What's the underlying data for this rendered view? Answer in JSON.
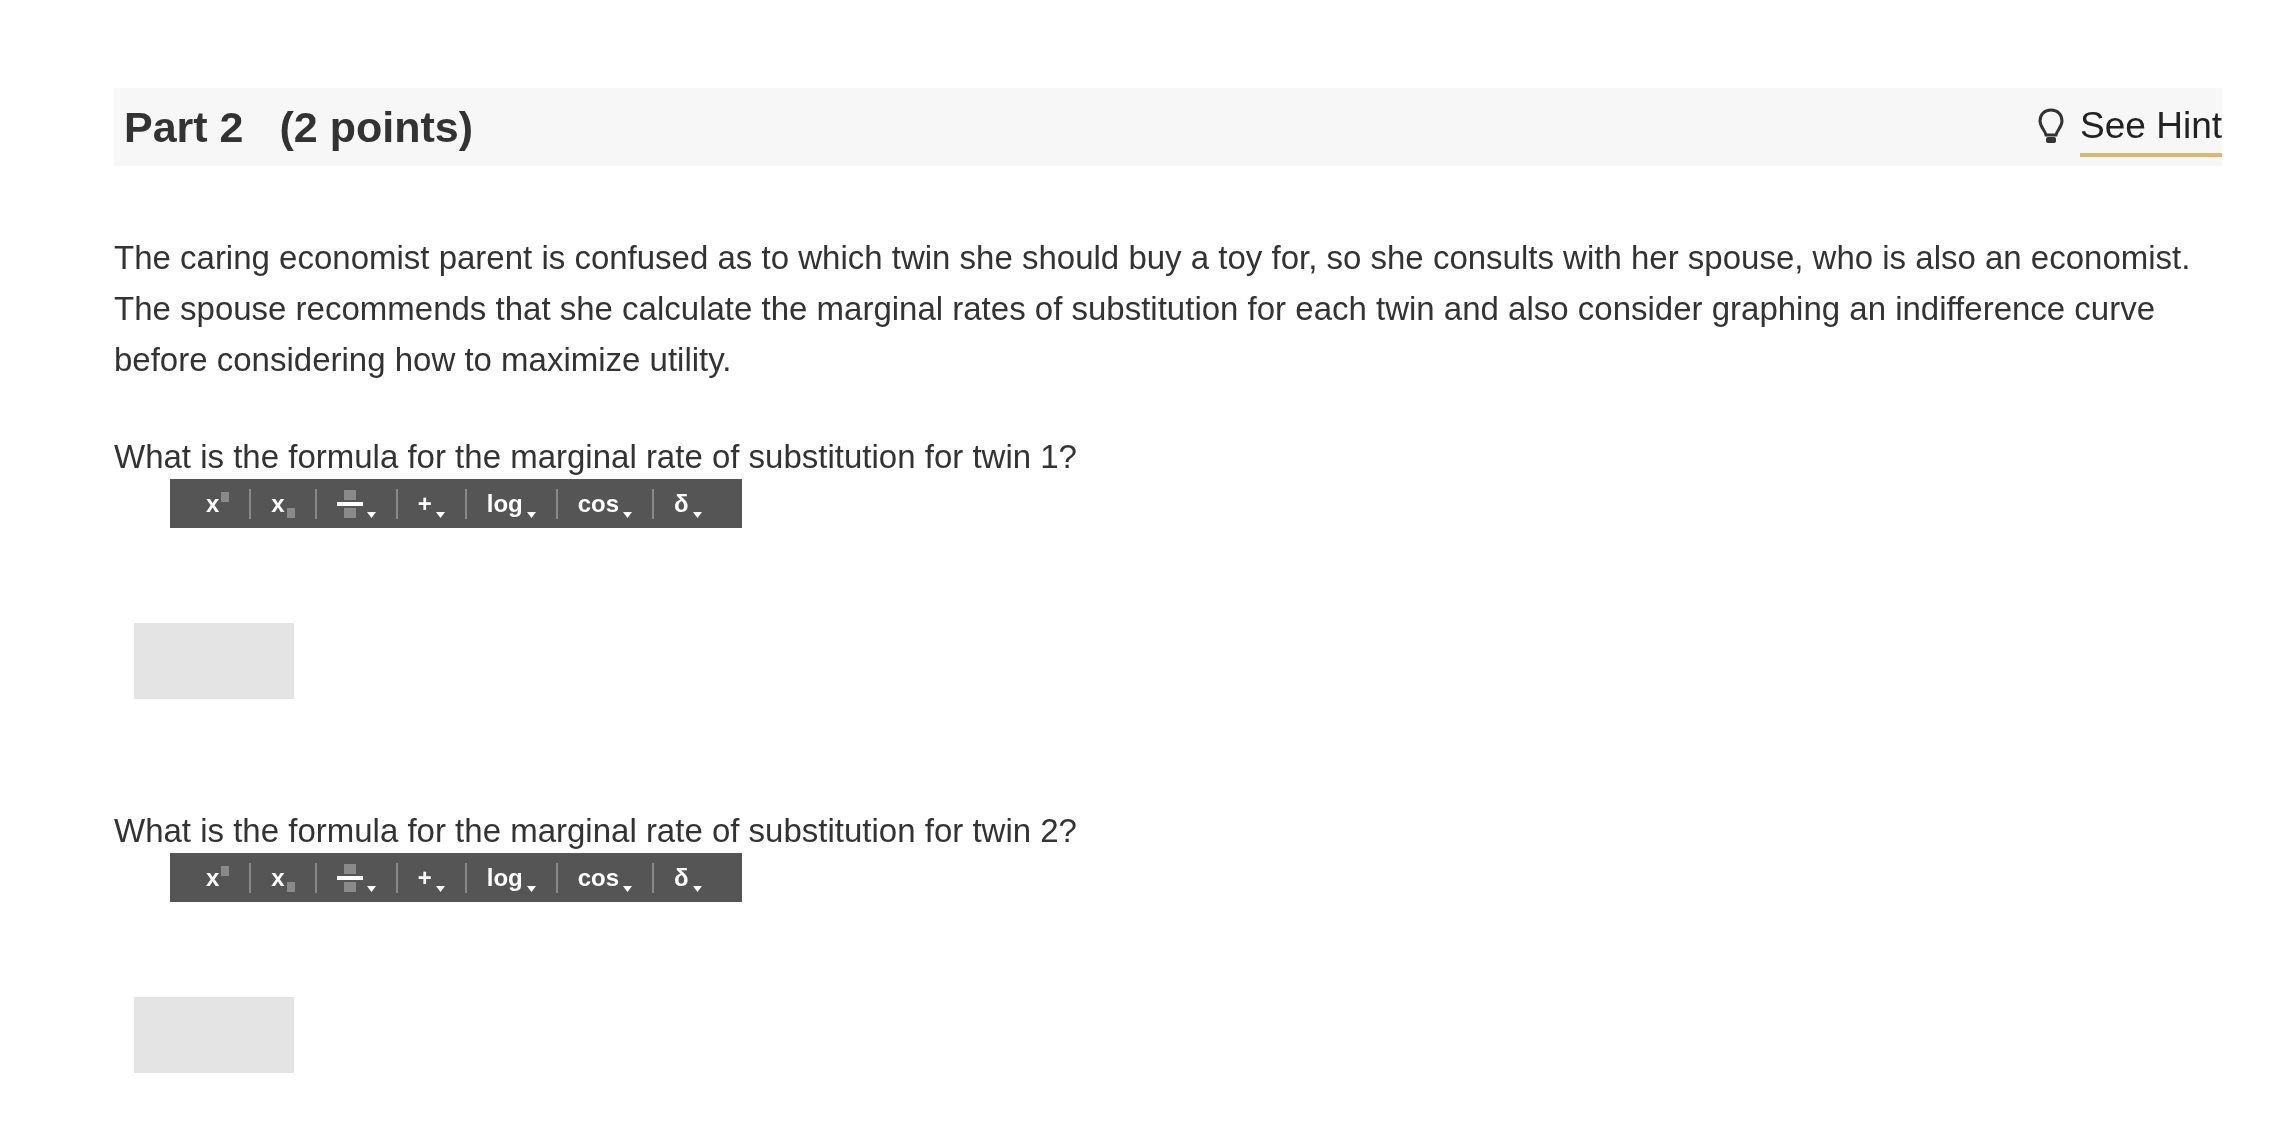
{
  "part": {
    "title": "Part 2",
    "points": "(2 points)",
    "hint_link": "See Hint"
  },
  "intro": "The caring economist parent is confused as to which twin she should buy a toy for, so she consults with her spouse, who is also an economist. The spouse recommends that she calculate the marginal rates of substitution for each twin and also consider graphing an indifference curve before considering how to maximize utility.",
  "questions": [
    {
      "prompt": "What is the formula for the marginal rate of substitution for twin 1?",
      "toolbar": [
        {
          "kind": "superscript",
          "label": "x"
        },
        {
          "kind": "subscript",
          "label": "x"
        },
        {
          "kind": "fraction"
        },
        {
          "kind": "menu",
          "label": "+"
        },
        {
          "kind": "menu",
          "label": "log"
        },
        {
          "kind": "menu",
          "label": "cos"
        },
        {
          "kind": "menu",
          "label": "δ"
        }
      ]
    },
    {
      "prompt": "What is the formula for the marginal rate of substitution for twin 2?",
      "toolbar": [
        {
          "kind": "superscript",
          "label": "x"
        },
        {
          "kind": "subscript",
          "label": "x"
        },
        {
          "kind": "fraction"
        },
        {
          "kind": "menu",
          "label": "+"
        },
        {
          "kind": "menu",
          "label": "log"
        },
        {
          "kind": "menu",
          "label": "cos"
        },
        {
          "kind": "menu",
          "label": "δ"
        }
      ]
    }
  ]
}
